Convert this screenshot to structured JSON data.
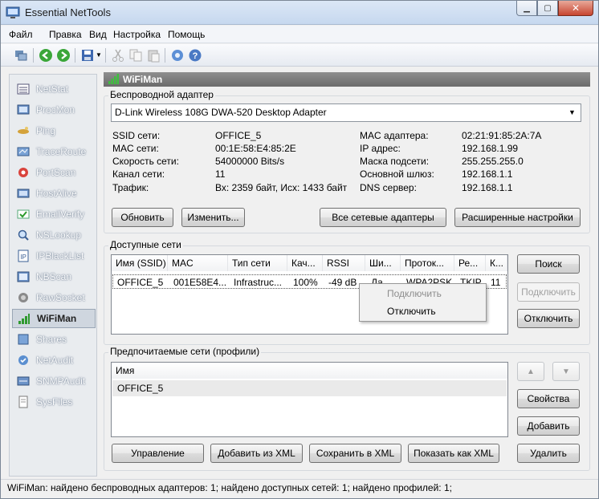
{
  "window": {
    "title": "Essential NetTools",
    "min": "▁",
    "max": "▢",
    "close": "✕"
  },
  "menu": [
    "Файл",
    "Правка",
    "Вид",
    "Настройка",
    "Помощь"
  ],
  "toolbar_icons": [
    "network-icon",
    "back-icon",
    "forward-icon",
    "save-icon",
    "cut-icon",
    "copy-icon",
    "paste-icon",
    "settings-icon",
    "help-icon"
  ],
  "sidebar": {
    "items": [
      {
        "label": "NetStat",
        "icon": "netstat-icon"
      },
      {
        "label": "ProcMon",
        "icon": "procmon-icon"
      },
      {
        "label": "Ping",
        "icon": "ping-icon"
      },
      {
        "label": "TraceRoute",
        "icon": "traceroute-icon"
      },
      {
        "label": "PortScan",
        "icon": "portscan-icon"
      },
      {
        "label": "HostAlive",
        "icon": "hostalive-icon"
      },
      {
        "label": "EmailVerify",
        "icon": "emailverify-icon"
      },
      {
        "label": "NSLookup",
        "icon": "nslookup-icon"
      },
      {
        "label": "IPBlackList",
        "icon": "ipblacklist-icon"
      },
      {
        "label": "NBScan",
        "icon": "nbscan-icon"
      },
      {
        "label": "RawSocket",
        "icon": "rawsocket-icon"
      },
      {
        "label": "WiFiMan",
        "icon": "wifi-icon",
        "active": true
      },
      {
        "label": "Shares",
        "icon": "shares-icon"
      },
      {
        "label": "NetAudit",
        "icon": "netaudit-icon"
      },
      {
        "label": "SNMPAudit",
        "icon": "snmpaudit-icon"
      },
      {
        "label": "SysFiles",
        "icon": "sysfiles-icon"
      }
    ]
  },
  "panel": {
    "title": "WiFiMan"
  },
  "adapter": {
    "group_label": "Беспроводной адаптер",
    "selected": "D-Link Wireless 108G DWA-520 Desktop Adapter",
    "left_labels": [
      "SSID сети:",
      "MAC сети:",
      "Скорость сети:",
      "Канал сети:",
      "Трафик:"
    ],
    "left_values": [
      "OFFICE_5",
      "00:1E:58:E4:85:2E",
      "54000000 Bits/s",
      "11",
      "Вх: 2359 байт, Исх: 1433 байт"
    ],
    "right_labels": [
      "MAC адаптера:",
      "IP адрес:",
      "Маска подсети:",
      "Основной шлюз:",
      "DNS сервер:"
    ],
    "right_values": [
      "02:21:91:85:2A:7A",
      "192.168.1.99",
      "255.255.255.0",
      "192.168.1.1",
      "192.168.1.1"
    ],
    "buttons": {
      "refresh": "Обновить",
      "change": "Изменить...",
      "all_adapters": "Все сетевые адаптеры",
      "advanced": "Расширенные настройки"
    }
  },
  "networks": {
    "group_label": "Доступные сети",
    "columns": [
      "Имя (SSID)",
      "MAC",
      "Тип сети",
      "Кач...",
      "RSSI",
      "Ши...",
      "Проток...",
      "Ре...",
      "К..."
    ],
    "rows": [
      [
        "OFFICE_5",
        "001E58E4...",
        "Infrastruc...",
        "100%",
        "-49 dB",
        "Да",
        "WPA2PSK",
        "TKIP",
        "11"
      ]
    ],
    "buttons": {
      "search": "Поиск",
      "connect": "Подключить",
      "disconnect": "Отключить"
    },
    "context_menu": {
      "connect": "Подключить",
      "disconnect": "Отключить"
    }
  },
  "profiles": {
    "group_label": "Предпочитаемые сети (профили)",
    "column": "Имя",
    "rows": [
      "OFFICE_5"
    ],
    "buttons": {
      "up": "▲",
      "down": "▼",
      "properties": "Свойства",
      "add": "Добавить",
      "delete": "Удалить",
      "manage": "Управление",
      "add_xml": "Добавить из XML",
      "save_xml": "Сохранить в XML",
      "show_xml": "Показать как XML"
    }
  },
  "status": "WiFiMan: найдено беспроводных адаптеров: 1; найдено доступных сетей: 1; найдено профилей: 1;"
}
